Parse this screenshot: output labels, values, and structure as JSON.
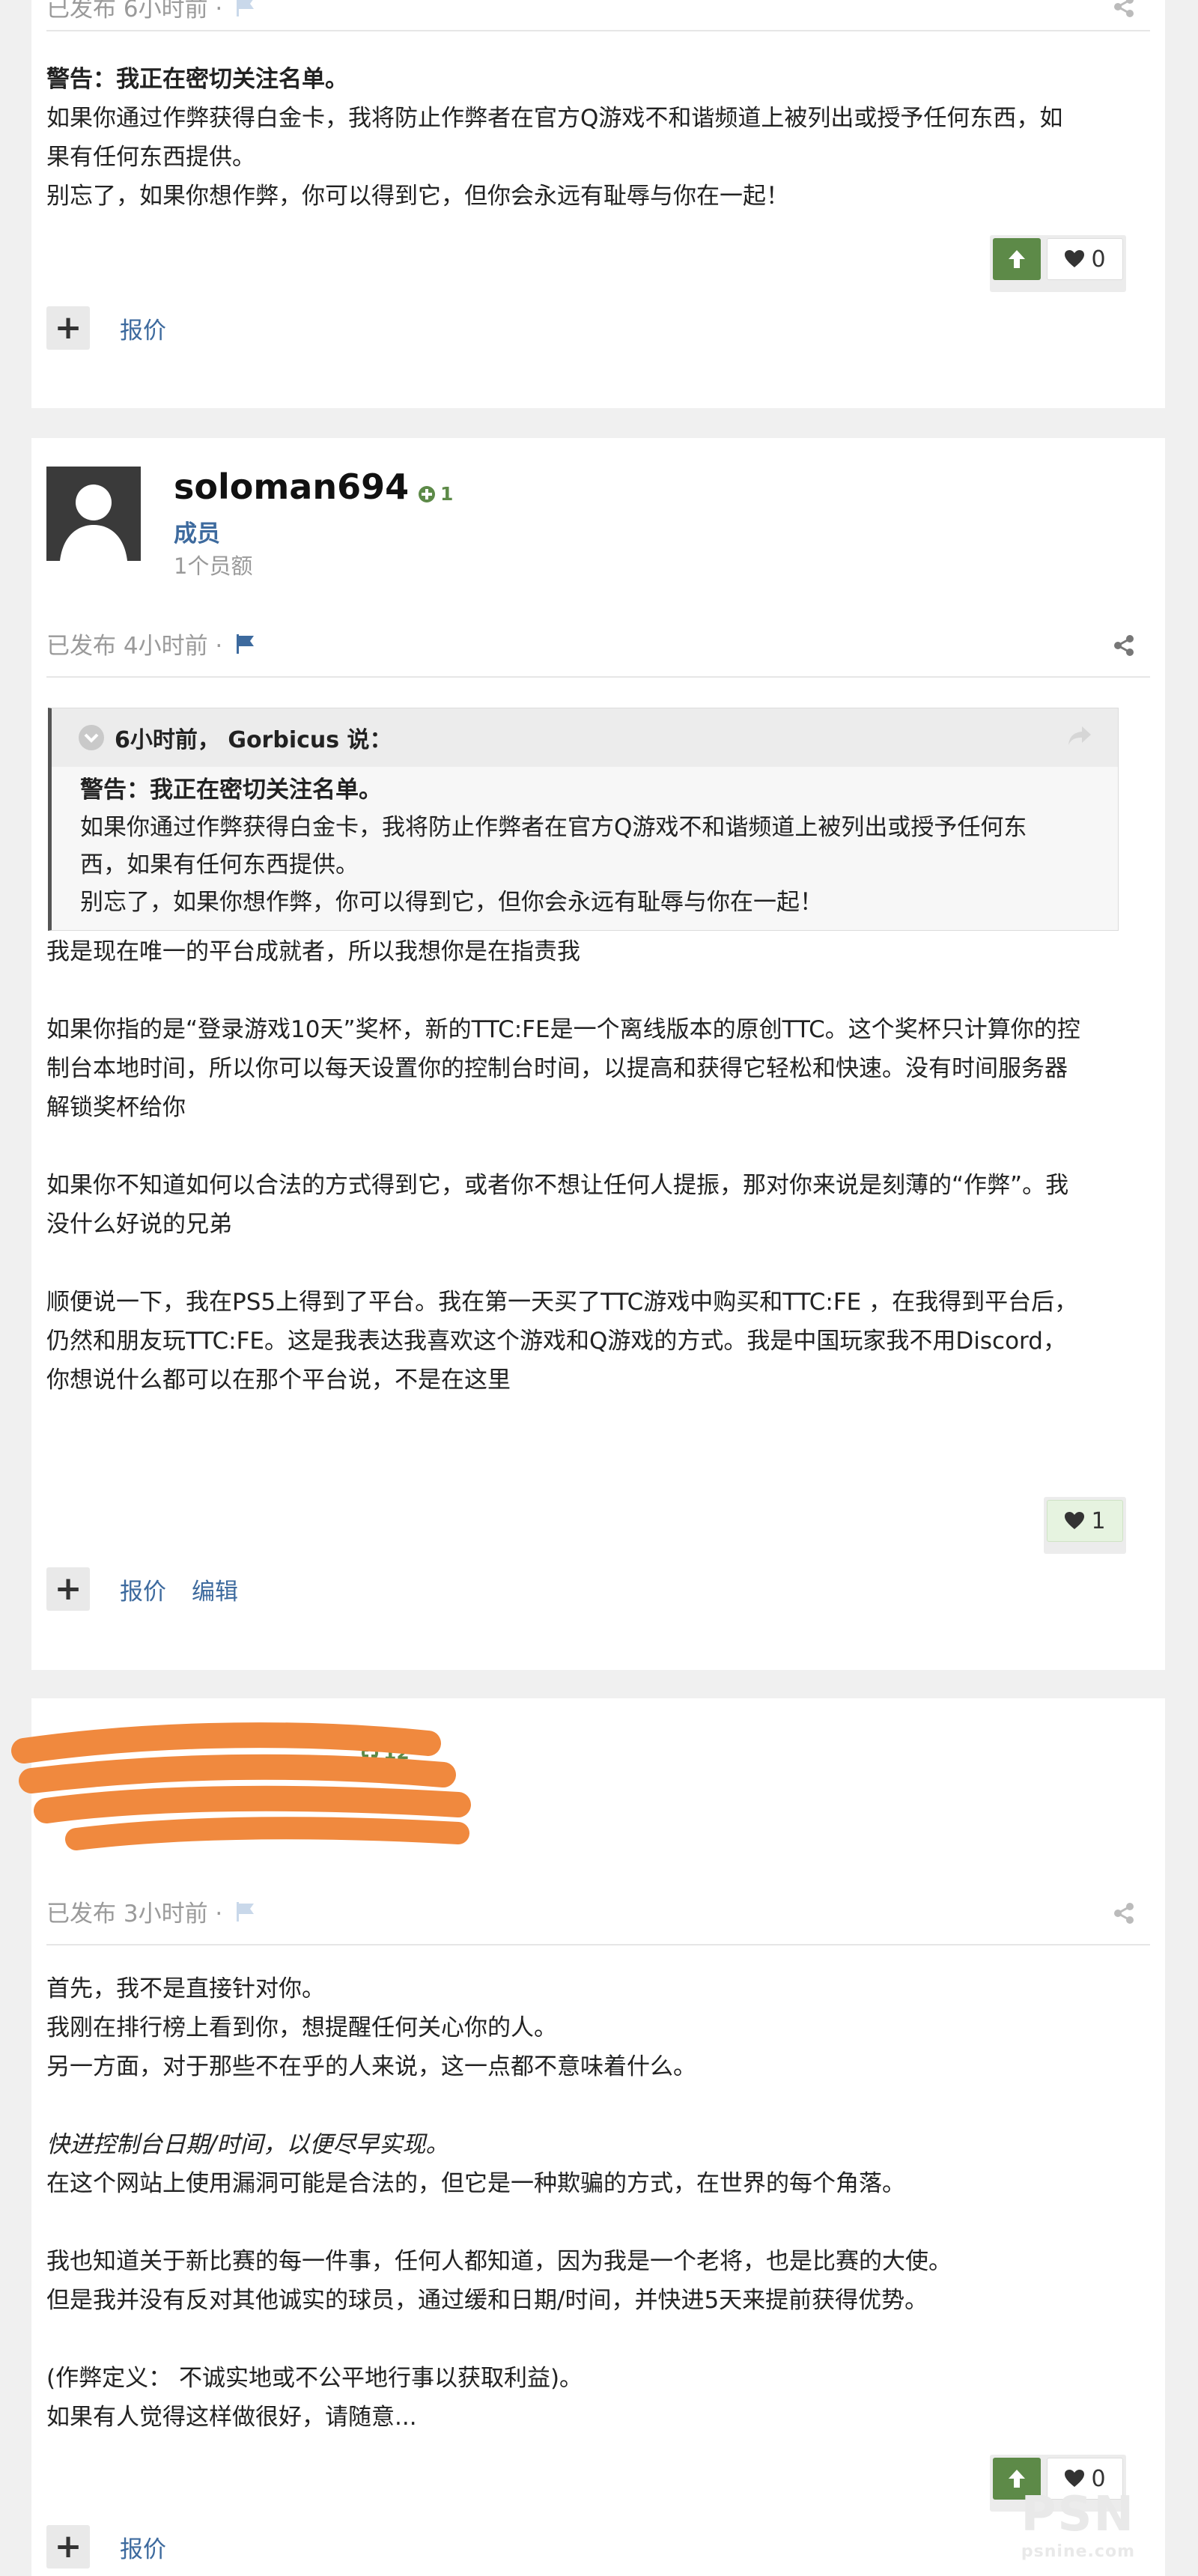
{
  "post1": {
    "meta": "已发布 6小时前 ·",
    "warning": "警告：我正在密切关注名单。",
    "line1": "如果你通过作弊获得白金卡，我将防止作弊者在官方Q游戏不和谐频道上被列出或授予任何东西，如",
    "line2": "果有任何东西提供。",
    "line3": "别忘了，如果你想作弊，你可以得到它，但你会永远有耻辱与你在一起！",
    "likes": "0",
    "plus_label": "+",
    "quote_label": "报价"
  },
  "post2": {
    "username": "soloman694",
    "reputation": "1",
    "role": "成员",
    "rank": "1个员额",
    "meta": "已发布 4小时前 ·",
    "quote_header": "6小时前， Gorbicus 说：",
    "quote_warning": "警告：我正在密切关注名单。",
    "quote_line1": "如果你通过作弊获得白金卡，我将防止作弊者在官方Q游戏不和谐频道上被列出或授予任何东",
    "quote_line2": "西，如果有任何东西提供。",
    "quote_line3": "别忘了，如果你想作弊，你可以得到它，但你会永远有耻辱与你在一起！",
    "para1": "我是现在唯一的平台成就者，所以我想你是在指责我",
    "para2_l1": "如果你指的是“登录游戏10天”奖杯，新的TTC:FE是一个离线版本的原创TTC。这个奖杯只计算你的控",
    "para2_l2": "制台本地时间，所以你可以每天设置你的控制台时间，以提高和获得它轻松和快速。没有时间服务器",
    "para2_l3": "解锁奖杯给你",
    "para3_l1": "如果你不知道如何以合法的方式得到它，或者你不想让任何人提振，那对你来说是刻薄的“作弊”。我",
    "para3_l2": "没什么好说的兄弟",
    "para4_l1": "顺便说一下，我在PS5上得到了平台。我在第一天买了TTC游戏中购买和TTC:FE ，在我得到平台后，",
    "para4_l2": "仍然和朋友玩TTC:FE。这是我表达我喜欢这个游戏和Q游戏的方式。我是中国玩家我不用Discord，",
    "para4_l3": "你想说什么都可以在那个平台说，不是在这里",
    "likes": "1",
    "plus_label": "+",
    "quote_label": "报价",
    "edit_label": "编辑"
  },
  "post3": {
    "reputation": "12",
    "meta": "已发布 3小时前 ·",
    "l1": "首先，我不是直接针对你。",
    "l2": "我刚在排行榜上看到你，想提醒任何关心你的人。",
    "l3": "另一方面，对于那些不在乎的人来说，这一点都不意味着什么。",
    "l4": "快进控制台日期/时间，以便尽早实现。",
    "l5": "在这个网站上使用漏洞可能是合法的，但它是一种欺骗的方式，在世界的每个角落。",
    "l6": "我也知道关于新比赛的每一件事，任何人都知道，因为我是一个老将，也是比赛的大使。",
    "l7": "但是我并没有反对其他诚实的球员，通过缓和日期/时间，并快进5天来提前获得优势。",
    "l8": "(作弊定义： 不诚实地或不公平地行事以获取利益)。",
    "l9": "如果有人觉得这样做很好，请随意...",
    "likes": "0",
    "plus_label": "+",
    "quote_label": "报价"
  },
  "watermark": {
    "brand": "PSN",
    "sub": "psnine.com"
  },
  "colors": {
    "accent_green": "#5d8a48",
    "link_blue": "#3d6a9e",
    "flag_blue": "#3d6a9e",
    "redaction": "#f0893e"
  }
}
